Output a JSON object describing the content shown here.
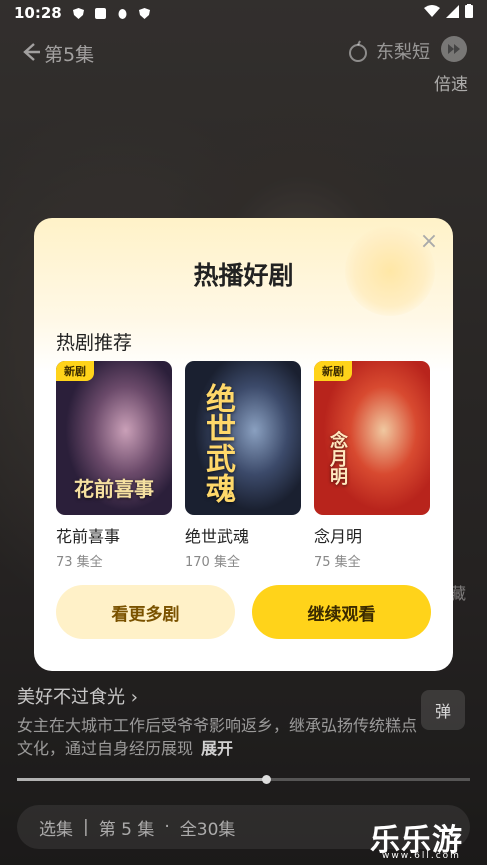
{
  "status_bar": {
    "time": "10:28"
  },
  "top_nav": {
    "episode_title": "第5集",
    "brand": "东梨短",
    "speed_label": "倍速"
  },
  "side": {
    "collect_label": "藏"
  },
  "modal": {
    "title": "热播好剧",
    "section_title": "热剧推荐",
    "dramas": [
      {
        "name": "花前喜事",
        "episodes": "73 集全",
        "badge": "新剧",
        "poster_text": "花前喜事",
        "colors": [
          "#2b1f3a",
          "#6b4a6a",
          "#caa0b8"
        ]
      },
      {
        "name": "绝世武魂",
        "episodes": "170 集全",
        "badge": "",
        "poster_text": "绝世武魂",
        "colors": [
          "#1a2030",
          "#3c4a6a",
          "#8aa0c0"
        ]
      },
      {
        "name": "念月明",
        "episodes": "75 集全",
        "badge": "新剧",
        "poster_text": "念月明",
        "colors": [
          "#b8241c",
          "#d84a30",
          "#f0c8a0"
        ]
      }
    ],
    "more_button": "看更多剧",
    "continue_button": "继续观看",
    "close_glyph": "×"
  },
  "player": {
    "show_title": "美好不过食光 ›",
    "description": "女主在大城市工作后受爷爷影响返乡，继承弘扬传统糕点文化，通过自身经历展现",
    "expand_label": "展开",
    "danmu_label": "弹",
    "progress": 0.55,
    "episode_bar": {
      "select": "选集",
      "current": "第 5 集",
      "total": "全30集"
    }
  },
  "watermark": {
    "text": "乐乐游戏",
    "sub": "www.6ll.com"
  },
  "colors": {
    "accent": "#ffd31a",
    "accent_soft": "#fff1c8",
    "text_dark": "#222222"
  }
}
